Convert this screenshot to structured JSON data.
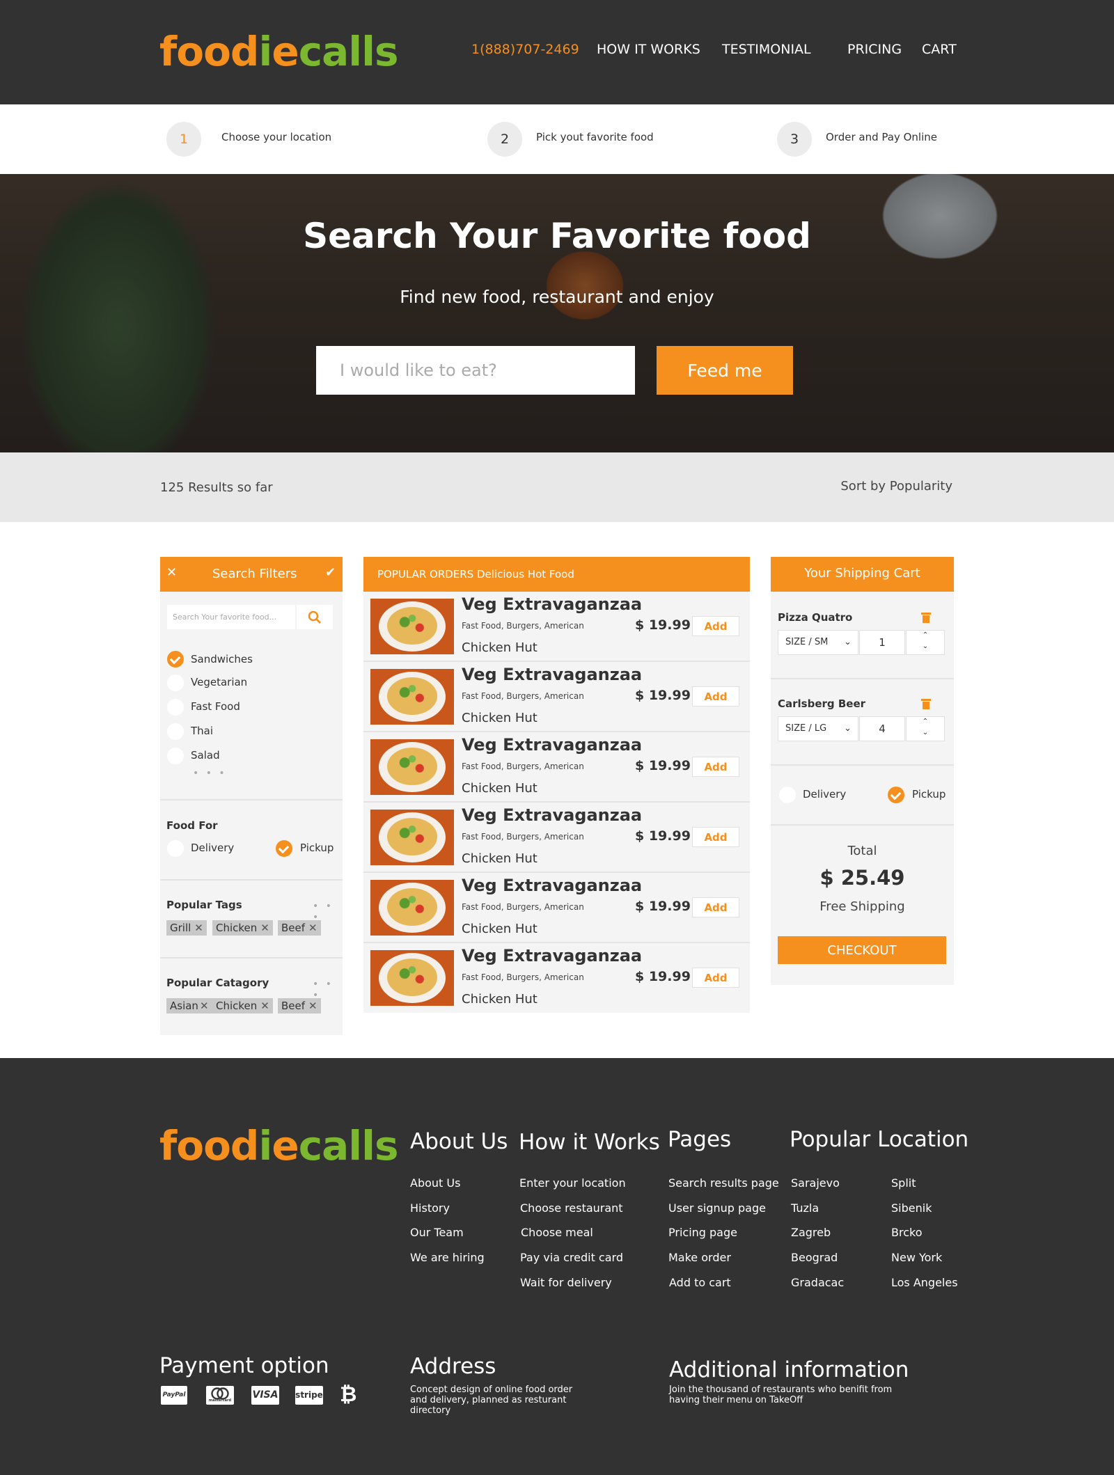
{
  "brand": {
    "logo_part1": "food",
    "logo_mark": "i",
    "logo_part2": "e",
    "logo_part3": "ca",
    "logo_part4": "lls"
  },
  "nav": {
    "phone": "1(888)707-2469",
    "how_it_works": "HOW IT WORKS",
    "testimonial": "TESTIMONIAL",
    "pricing": "PRICING",
    "cart": "CART"
  },
  "steps": [
    {
      "num": "1",
      "text": "Choose your location"
    },
    {
      "num": "2",
      "text": "Pick yout favorite food"
    },
    {
      "num": "3",
      "text": "Order and Pay Online"
    }
  ],
  "hero": {
    "title": "Search Your Favorite food",
    "subtitle": "Find new food, restaurant and enjoy",
    "placeholder": "I would like to eat?",
    "button": "Feed me"
  },
  "results": {
    "count": "125 Results so far",
    "sort": "Sort by Popularity"
  },
  "filters": {
    "title": "Search Filters",
    "search_placeholder": "Search Your favorite food...",
    "categories": [
      {
        "label": "Sandwiches",
        "checked": true
      },
      {
        "label": "Vegetarian",
        "checked": false
      },
      {
        "label": "Fast Food",
        "checked": false
      },
      {
        "label": "Thai",
        "checked": false
      },
      {
        "label": "Salad",
        "checked": false
      }
    ],
    "food_for": {
      "title": "Food For",
      "delivery": "Delivery",
      "pickup": "Pickup",
      "selected": "pickup"
    },
    "popular_tags": {
      "title": "Popular Tags",
      "tags": [
        "Grill",
        "Chicken",
        "Beef"
      ]
    },
    "popular_category": {
      "title": "Popular Catagory",
      "tags": [
        "Asian",
        "Chicken",
        "Beef"
      ]
    }
  },
  "orders": {
    "title": "POPULAR ORDERS Delicious Hot Food",
    "items": [
      {
        "name": "Veg Extravaganzaa",
        "cats": "Fast Food, Burgers, American",
        "restaurant": "Chicken Hut",
        "price": "$ 19.99",
        "add": "Add"
      },
      {
        "name": "Veg Extravaganzaa",
        "cats": "Fast Food, Burgers, American",
        "restaurant": "Chicken Hut",
        "price": "$ 19.99",
        "add": "Add"
      },
      {
        "name": "Veg Extravaganzaa",
        "cats": "Fast Food, Burgers, American",
        "restaurant": "Chicken Hut",
        "price": "$ 19.99",
        "add": "Add"
      },
      {
        "name": "Veg Extravaganzaa",
        "cats": "Fast Food, Burgers, American",
        "restaurant": "Chicken Hut",
        "price": "$ 19.99",
        "add": "Add"
      },
      {
        "name": "Veg Extravaganzaa",
        "cats": "Fast Food, Burgers, American",
        "restaurant": "Chicken Hut",
        "price": "$ 19.99",
        "add": "Add"
      },
      {
        "name": "Veg Extravaganzaa",
        "cats": "Fast Food, Burgers, American",
        "restaurant": "Chicken Hut",
        "price": "$ 19.99",
        "add": "Add"
      }
    ]
  },
  "cart": {
    "title": "Your Shipping Cart",
    "items": [
      {
        "name": "Pizza Quatro",
        "size": "SIZE / SM",
        "qty": "1"
      },
      {
        "name": "Carlsberg Beer",
        "size": "SIZE / LG",
        "qty": "4"
      }
    ],
    "delivery": "Delivery",
    "pickup": "Pickup",
    "selected": "pickup",
    "total_label": "Total",
    "total": "$ 25.49",
    "shipping": "Free Shipping",
    "checkout": "CHECKOUT"
  },
  "footer": {
    "about": {
      "title": "About Us",
      "links": [
        "About Us",
        "History",
        "Our Team",
        "We are hiring"
      ]
    },
    "how": {
      "title": "How it Works",
      "links": [
        "Enter your location",
        "Choose restaurant",
        "Choose meal",
        "Pay via credit card",
        "Wait for delivery"
      ]
    },
    "pages": {
      "title": "Pages",
      "links": [
        "Search results page",
        "User signup page",
        "Pricing page",
        "Make order",
        "Add to cart"
      ]
    },
    "locations": {
      "title": "Popular Location",
      "col1": [
        "Sarajevo",
        "Tuzla",
        "Zagreb",
        "Beograd",
        "Gradacac"
      ],
      "col2": [
        "Split",
        "Sibenik",
        "Brcko",
        "New York",
        "Los Angeles"
      ]
    },
    "payment": {
      "title": "Payment option",
      "icons": [
        "PayPal",
        "mastercard",
        "VISA",
        "stripe",
        "₿"
      ]
    },
    "address": {
      "title": "Address",
      "text": "Concept design of online food order and delivery, planned as resturant directory"
    },
    "additional": {
      "title": "Additional information",
      "text": "Join the thousand of restaurants who benifit from having their menu on TakeOff"
    }
  },
  "colors": {
    "accent": "#f5901e",
    "green": "#7cb82f",
    "dark": "#323232",
    "panel": "#f4f4f4"
  }
}
